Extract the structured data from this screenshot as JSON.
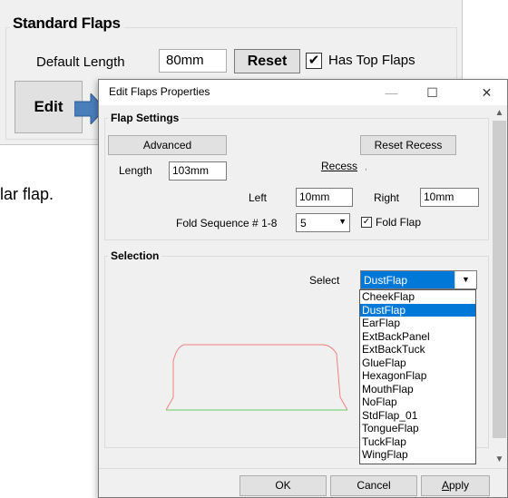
{
  "background": {
    "group_title": "Standard Flaps",
    "default_length_label": "Default Length",
    "default_length_value": "80mm",
    "reset_label": "Reset",
    "has_top_flaps_checked": true,
    "has_top_flaps_label": "Has Top Flaps",
    "edit_label": "Edit",
    "partial_text": "lar flap."
  },
  "dialog": {
    "title": "Edit Flaps Properties",
    "titlebar_buttons": {
      "minimize": "—",
      "maximize": "☐",
      "close": "✕"
    },
    "flap_settings": {
      "title": "Flap Settings",
      "advanced_label": "Advanced",
      "reset_recess_label": "Reset Recess",
      "length_label": "Length",
      "length_value": "103mm",
      "recess_label": "Recess",
      "left_label": "Left",
      "left_value": "10mm",
      "right_label": "Right",
      "right_value": "10mm",
      "fold_sequence_label": "Fold Sequence # 1-8",
      "fold_sequence_value": "5",
      "fold_flap_checked": true,
      "fold_flap_label": "Fold Flap"
    },
    "selection": {
      "title": "Selection",
      "select_label": "Select",
      "selected_value": "DustFlap",
      "options": [
        "CheekFlap",
        "DustFlap",
        "EarFlap",
        "ExtBackPanel",
        "ExtBackTuck",
        "GlueFlap",
        "HexagonFlap",
        "MouthFlap",
        "NoFlap",
        "StdFlap_01",
        "TongueFlap",
        "TuckFlap",
        "WingFlap"
      ],
      "highlighted_index": 1
    },
    "buttons": {
      "ok": "OK",
      "cancel": "Cancel",
      "apply": "Apply"
    }
  },
  "colors": {
    "selection_blue": "#0078d7",
    "arrow_blue": "#4a7ebb",
    "flap_outline_red": "#f08080",
    "flap_base_green": "#66cc66"
  }
}
